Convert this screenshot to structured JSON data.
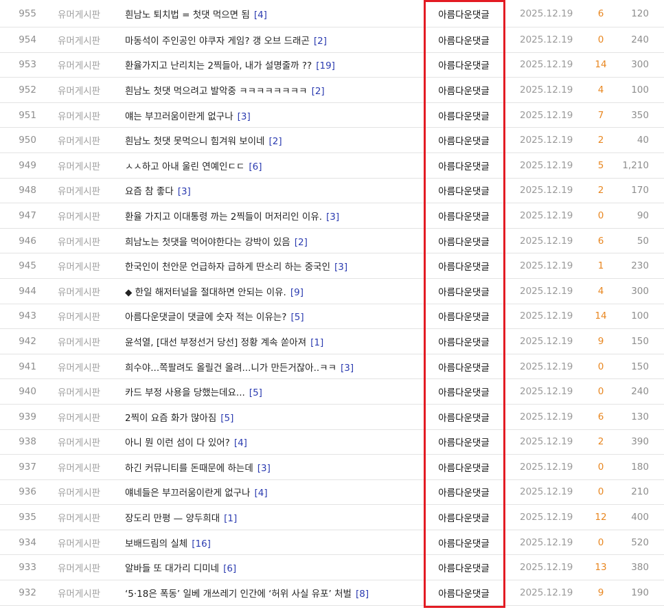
{
  "highlight": {
    "color": "#e31b23"
  },
  "posts": [
    {
      "num": "955",
      "category": "유머게시판",
      "title": "흰남노 퇴치법 = 첫댓 먹으면 됨",
      "replies": "[4]",
      "author": "아름다운댓글",
      "date": "2025.12.19",
      "comments": "6",
      "views": "120"
    },
    {
      "num": "954",
      "category": "유머게시판",
      "title": "마동석이 주인공인 야쿠자 게임? 갱 오브 드래곤",
      "replies": "[2]",
      "author": "아름다운댓글",
      "date": "2025.12.19",
      "comments": "0",
      "views": "240"
    },
    {
      "num": "953",
      "category": "유머게시판",
      "title": "환율가지고 난리치는 2찍들아, 내가 설명줄까 ??",
      "replies": "[19]",
      "author": "아름다운댓글",
      "date": "2025.12.19",
      "comments": "14",
      "views": "300"
    },
    {
      "num": "952",
      "category": "유머게시판",
      "title": "흰남노 첫댓 먹으려고 발악중 ㅋㅋㅋㅋㅋㅋㅋㅋ",
      "replies": "[2]",
      "author": "아름다운댓글",
      "date": "2025.12.19",
      "comments": "4",
      "views": "100"
    },
    {
      "num": "951",
      "category": "유머게시판",
      "title": "얘는 부끄러움이란게 없구나",
      "replies": "[3]",
      "author": "아름다운댓글",
      "date": "2025.12.19",
      "comments": "7",
      "views": "350"
    },
    {
      "num": "950",
      "category": "유머게시판",
      "title": "흰남노 첫댓 못먹으니 힘겨워 보이네",
      "replies": "[2]",
      "author": "아름다운댓글",
      "date": "2025.12.19",
      "comments": "2",
      "views": "40"
    },
    {
      "num": "949",
      "category": "유머게시판",
      "title": "ㅅㅅ하고 아내 울린 연예인ㄷㄷ",
      "replies": "[6]",
      "author": "아름다운댓글",
      "date": "2025.12.19",
      "comments": "5",
      "views": "1,210"
    },
    {
      "num": "948",
      "category": "유머게시판",
      "title": "요즘 참 좋다",
      "replies": "[3]",
      "author": "아름다운댓글",
      "date": "2025.12.19",
      "comments": "2",
      "views": "170"
    },
    {
      "num": "947",
      "category": "유머게시판",
      "title": "환율 가지고 이대통령 까는 2찍들이 머저리인 이유.",
      "replies": "[3]",
      "author": "아름다운댓글",
      "date": "2025.12.19",
      "comments": "0",
      "views": "90"
    },
    {
      "num": "946",
      "category": "유머게시판",
      "title": "희남노는 첫댓을 먹어야한다는 강박이 있음",
      "replies": "[2]",
      "author": "아름다운댓글",
      "date": "2025.12.19",
      "comments": "6",
      "views": "50"
    },
    {
      "num": "945",
      "category": "유머게시판",
      "title": "한국인이 천안문 언급하자 급하게 딴소리 하는 중국인",
      "replies": "[3]",
      "author": "아름다운댓글",
      "date": "2025.12.19",
      "comments": "1",
      "views": "230"
    },
    {
      "num": "944",
      "category": "유머게시판",
      "title": "◆ 한일 해저터널을 절대하면 안되는 이유.",
      "replies": "[9]",
      "author": "아름다운댓글",
      "date": "2025.12.19",
      "comments": "4",
      "views": "300"
    },
    {
      "num": "943",
      "category": "유머게시판",
      "title": "아름다운댓글이 댓글에 숫자 적는 이유는?",
      "replies": "[5]",
      "author": "아름다운댓글",
      "date": "2025.12.19",
      "comments": "14",
      "views": "100"
    },
    {
      "num": "942",
      "category": "유머게시판",
      "title": "윤석열, [대선 부정선거 당선] 정황 계속 쏟아져",
      "replies": "[1]",
      "author": "아름다운댓글",
      "date": "2025.12.19",
      "comments": "9",
      "views": "150"
    },
    {
      "num": "941",
      "category": "유머게시판",
      "title": "희수야...쪽팔려도 올릴건 올려...니가 만든거잖아..ㅋㅋ",
      "replies": "[3]",
      "author": "아름다운댓글",
      "date": "2025.12.19",
      "comments": "0",
      "views": "150"
    },
    {
      "num": "940",
      "category": "유머게시판",
      "title": "카드 부정 사용을 당했는데요...",
      "replies": "[5]",
      "author": "아름다운댓글",
      "date": "2025.12.19",
      "comments": "0",
      "views": "240"
    },
    {
      "num": "939",
      "category": "유머게시판",
      "title": "2찍이 요즘 화가 많아짐",
      "replies": "[5]",
      "author": "아름다운댓글",
      "date": "2025.12.19",
      "comments": "6",
      "views": "130"
    },
    {
      "num": "938",
      "category": "유머게시판",
      "title": "아니 뭔 이런 섬이 다 있어?",
      "replies": "[4]",
      "author": "아름다운댓글",
      "date": "2025.12.19",
      "comments": "2",
      "views": "390"
    },
    {
      "num": "937",
      "category": "유머게시판",
      "title": "하긴 커뮤니티를 돈때문에 하는데",
      "replies": "[3]",
      "author": "아름다운댓글",
      "date": "2025.12.19",
      "comments": "0",
      "views": "180"
    },
    {
      "num": "936",
      "category": "유머게시판",
      "title": "얘네들은 부끄러움이란게 없구나",
      "replies": "[4]",
      "author": "아름다운댓글",
      "date": "2025.12.19",
      "comments": "0",
      "views": "210"
    },
    {
      "num": "935",
      "category": "유머게시판",
      "title": "장도리 만평 — 양두희대",
      "replies": "[1]",
      "author": "아름다운댓글",
      "date": "2025.12.19",
      "comments": "12",
      "views": "400"
    },
    {
      "num": "934",
      "category": "유머게시판",
      "title": "보배드림의 실체",
      "replies": "[16]",
      "author": "아름다운댓글",
      "date": "2025.12.19",
      "comments": "0",
      "views": "520"
    },
    {
      "num": "933",
      "category": "유머게시판",
      "title": "알바들 또 대가리 디미네",
      "replies": "[6]",
      "author": "아름다운댓글",
      "date": "2025.12.19",
      "comments": "13",
      "views": "380"
    },
    {
      "num": "932",
      "category": "유머게시판",
      "title": "‘5·18은 폭동’ 일베 개쓰레기 인간에 ‘허위 사실 유포’ 처벌",
      "replies": "[8]",
      "author": "아름다운댓글",
      "date": "2025.12.19",
      "comments": "9",
      "views": "190"
    }
  ]
}
